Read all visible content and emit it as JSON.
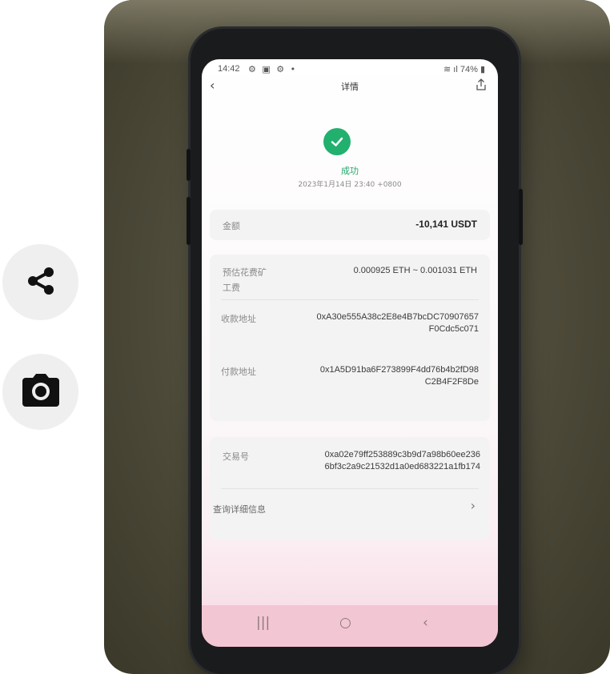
{
  "side_actions": {
    "share_icon": "share-icon",
    "camera_icon": "camera-icon"
  },
  "phone": {
    "status_bar": {
      "time": "14:42",
      "left_icons": "⚙ ▣ ⚙ •",
      "battery": "74%"
    },
    "header": {
      "back": "‹",
      "title": "详情"
    },
    "result": {
      "status": "成功",
      "datetime": "2023年1月14日 23:40 +0800"
    },
    "amount": {
      "label": "金额",
      "value": "-10,141 USDT"
    },
    "fee": {
      "label_line1": "预估花费矿",
      "label_line2": "工费",
      "value": "0.000925 ETH ~ 0.001031 ETH"
    },
    "to_address": {
      "label": "收款地址",
      "line1": "0xA30e555A38c2E8e4B7bcDC70907657",
      "line2": "F0Cdc5c071"
    },
    "from_address": {
      "label": "付款地址",
      "line1": "0x1A5D91ba6F273899F4dd76b4b2fD98",
      "line2": "C2B4F2F8De"
    },
    "tx": {
      "label": "交易号",
      "line1": "0xa02e79ff253889c3b9d7a98b60ee236",
      "line2": "6bf3c2a9c21532d1a0ed683221a1fb174"
    },
    "details_link": {
      "label": "查询详细信息",
      "chevron": "›"
    },
    "nav": {
      "recents": "|||",
      "home": "○",
      "back": "‹"
    }
  },
  "colors": {
    "success": "#22b06f",
    "nav_pink": "#f3c6d3"
  }
}
